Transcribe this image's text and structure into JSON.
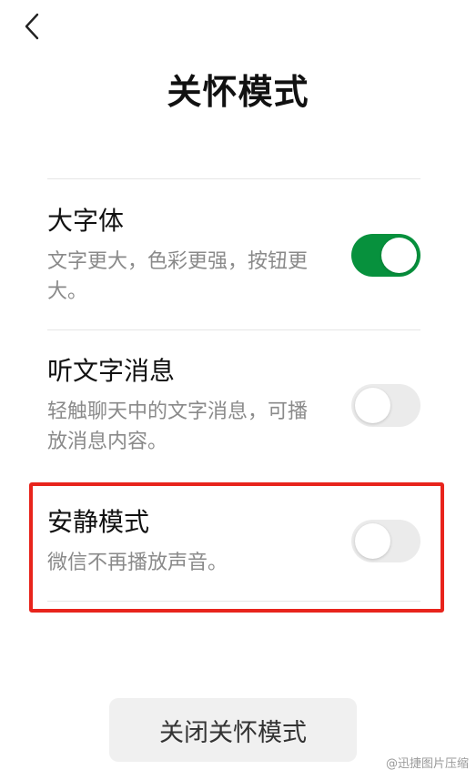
{
  "header": {
    "title": "关怀模式",
    "back_icon": "chevron-left-icon"
  },
  "settings": [
    {
      "title": "大字体",
      "description": "文字更大，色彩更强，按钮更大。",
      "enabled": true
    },
    {
      "title": "听文字消息",
      "description": "轻触聊天中的文字消息，可播放消息内容。",
      "enabled": false
    },
    {
      "title": "安静模式",
      "description": "微信不再播放声音。",
      "enabled": false
    }
  ],
  "close_button": {
    "label": "关闭关怀模式"
  },
  "watermark": {
    "text": "@迅捷图片压缩"
  },
  "colors": {
    "toggle_on": "#07913d",
    "toggle_off": "#ebebeb",
    "highlight": "#e8241c",
    "button_bg": "#f0f0f0"
  }
}
